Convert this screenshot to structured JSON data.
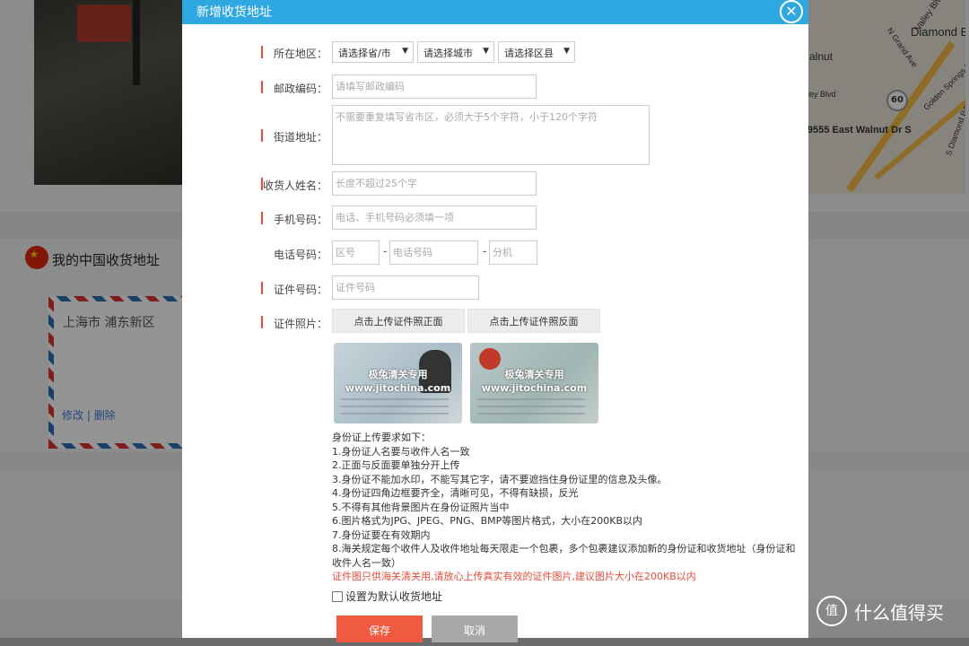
{
  "background": {
    "section_title": "我的中国收货地址",
    "address_city": "上海市 浦东新区",
    "edit_link": "修改",
    "delete_link": "删除",
    "map_labels": [
      "Valley Blvd",
      "Diamond B",
      "alnut",
      "N Grand Ave",
      "Golden Springs Dr",
      "ley Blvd",
      "60",
      "S Diamond Bar Blvd",
      "9555 East Walnut Dr S"
    ],
    "watermark": "什么值得买"
  },
  "modal": {
    "title": "新增收货地址",
    "close_icon": "close-icon",
    "labels": {
      "region": "所在地区：",
      "postcode": "邮政编码：",
      "street": "街道地址：",
      "name": "收货人姓名：",
      "mobile": "手机号码：",
      "phone": "电话号码：",
      "id_number": "证件号码：",
      "id_photo": "证件照片："
    },
    "selects": {
      "province": "请选择省/市",
      "city": "请选择城市",
      "district": "请选择区县"
    },
    "placeholders": {
      "postcode": "请填写邮政编码",
      "street": "不需要重复填写省市区，必须大于5个字符，小于120个字符",
      "name": "长度不超过25个字",
      "mobile": "电话、手机号码必须填一项",
      "area_code": "区号",
      "phone_number": "电话号码",
      "extension": "分机",
      "id_number": "证件号码"
    },
    "phone_separator": "-",
    "upload_front": "点击上传证件照正面",
    "upload_back": "点击上传证件照反面",
    "card_watermark_line1": "极兔清关专用",
    "card_watermark_line2": "www.jitochina.com",
    "requirements_title": "身份证上传要求如下：",
    "requirements": [
      "1.身份证人名要与收件人名一致",
      "2.正面与反面要单独分开上传",
      "3.身份证不能加水印，不能写其它字，请不要遮挡住身份证里的信息及头像。",
      "4.身份证四角边框要齐全，清晰可见，不得有缺损，反光",
      "5.不得有其他背景图片在身份证照片当中",
      "6.图片格式为JPG、JPEG、PNG、BMP等图片格式，大小在200KB以内",
      "7.身份证要在有效期内",
      "8.海关规定每个收件人及收件地址每天限走一个包裹，多个包裹建议添加新的身份证和收货地址（身份证和收件人名一致）"
    ],
    "warning": "证件图只供海关清关用,请放心上传真实有效的证件图片,建议图片大小在200KB以内",
    "default_checkbox": "设置为默认收货地址",
    "save": "保存",
    "cancel": "取消"
  },
  "colors": {
    "header": "#2fa8e2",
    "save": "#f05a3e",
    "required": "#e74c3c"
  }
}
